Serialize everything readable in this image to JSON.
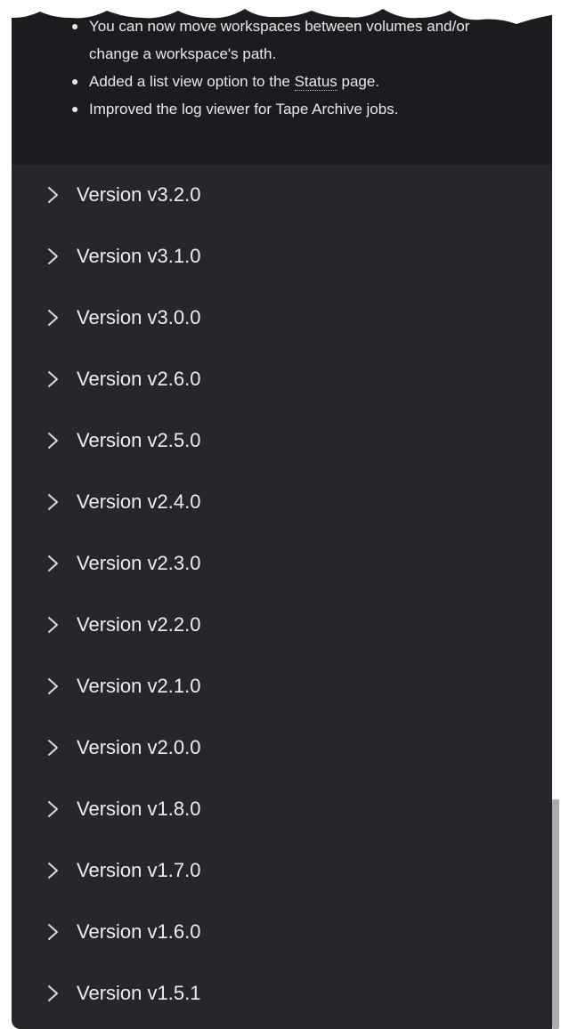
{
  "expanded_release": {
    "notes": [
      {
        "text": "You can now move workspaces between volumes and/or change a workspace's path."
      },
      {
        "before": "Added a list view option to the ",
        "link": "Status",
        "after": " page."
      },
      {
        "text": "Improved the log viewer for Tape Archive jobs."
      }
    ]
  },
  "versions": [
    {
      "label": "Version v3.2.0",
      "icon": "chevron-right-icon"
    },
    {
      "label": "Version v3.1.0",
      "icon": "chevron-right-icon"
    },
    {
      "label": "Version v3.0.0",
      "icon": "chevron-right-icon"
    },
    {
      "label": "Version v2.6.0",
      "icon": "chevron-right-icon"
    },
    {
      "label": "Version v2.5.0",
      "icon": "chevron-right-icon"
    },
    {
      "label": "Version v2.4.0",
      "icon": "chevron-right-icon"
    },
    {
      "label": "Version v2.3.0",
      "icon": "chevron-right-icon"
    },
    {
      "label": "Version v2.2.0",
      "icon": "chevron-right-icon"
    },
    {
      "label": "Version v2.1.0",
      "icon": "chevron-right-icon"
    },
    {
      "label": "Version v2.0.0",
      "icon": "chevron-right-icon"
    },
    {
      "label": "Version v1.8.0",
      "icon": "chevron-right-icon"
    },
    {
      "label": "Version v1.7.0",
      "icon": "chevron-right-icon"
    },
    {
      "label": "Version v1.6.0",
      "icon": "chevron-right-icon"
    },
    {
      "label": "Version v1.5.1",
      "icon": "chevron-right-icon"
    }
  ],
  "colors": {
    "panel_bg": "#26272b",
    "expanded_bg": "#1b1c1f",
    "text": "#eeeff2",
    "chevron": "#d9dade"
  }
}
